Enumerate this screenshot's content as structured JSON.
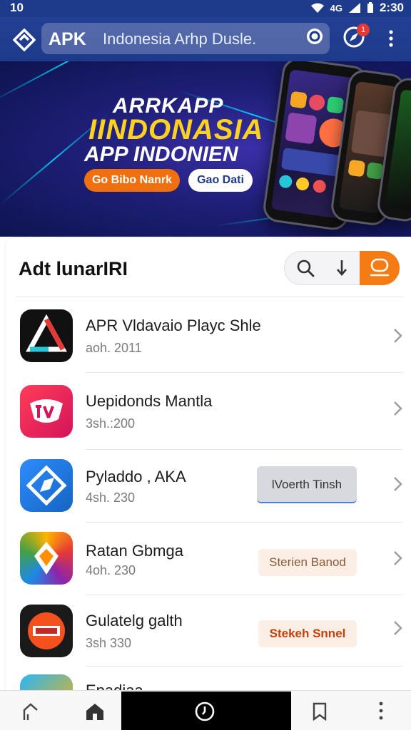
{
  "status_bar": {
    "left_time": "10",
    "right_time": "2:30",
    "network_label": "4G"
  },
  "search": {
    "brand": "APK",
    "query": "Indonesia Arhp Dusle.",
    "notification_count": "1"
  },
  "banner": {
    "subtitle": "ARRKAPP",
    "title": "IINDONASIA",
    "line3": "APP INDONIEN",
    "primary_button": "Go Bibo Nanrk",
    "secondary_button": "Gao Dati"
  },
  "section": {
    "title": "Adt lunarIRI"
  },
  "apps": [
    {
      "name": "APR Vldavaio Playc Shle",
      "meta": "aoh. 2011",
      "button": "",
      "icon": "triangle-logo-icon"
    },
    {
      "name": "Uepidonds Mantla",
      "meta": "3sh.:200",
      "button": "",
      "icon": "red-badge-icon"
    },
    {
      "name": "Pyladdo , AKA",
      "meta": "4sh. 230",
      "button": "lVoerth Tinsh",
      "icon": "blue-compass-icon"
    },
    {
      "name": "Ratan Gbmga",
      "meta": "4oh. 230",
      "button": "Sterien Banod",
      "icon": "colorful-gem-icon"
    },
    {
      "name": "Gulatelg galth",
      "meta": "3sh 330",
      "button": "Stekeh Snnel",
      "icon": "tpip-logo-icon"
    },
    {
      "name": "Epadiaa",
      "meta": "",
      "button": "",
      "icon": "partial-app-icon"
    }
  ],
  "colors": {
    "app_bar": "#1e3a8a",
    "accent_orange": "#f57c14",
    "banner_yellow": "#ffd21f",
    "banner_button_orange": "#f0700f"
  }
}
